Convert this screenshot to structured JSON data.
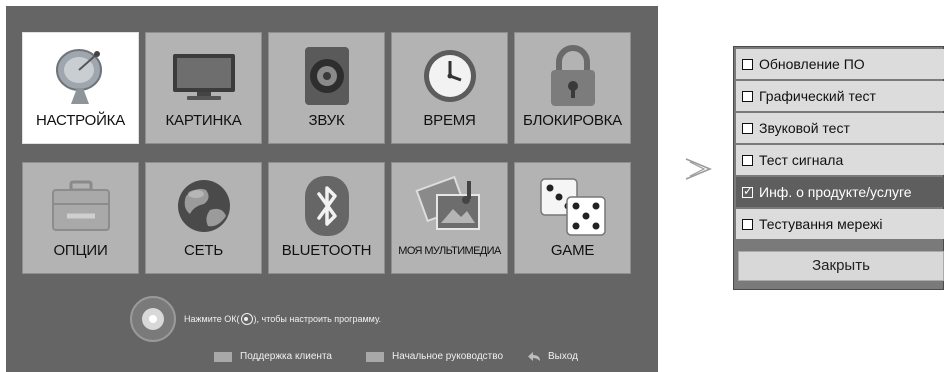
{
  "main_menu": {
    "tiles": [
      {
        "label": "НАСТРОЙКА",
        "icon": "satellite-dish-icon",
        "active": true
      },
      {
        "label": "КАРТИНКА",
        "icon": "tv-monitor-icon"
      },
      {
        "label": "ЗВУК",
        "icon": "speaker-icon"
      },
      {
        "label": "ВРЕМЯ",
        "icon": "clock-icon"
      },
      {
        "label": "БЛОКИРОВКА",
        "icon": "padlock-icon"
      },
      {
        "label": "ОПЦИИ",
        "icon": "toolbox-icon"
      },
      {
        "label": "СЕТЬ",
        "icon": "globe-icon"
      },
      {
        "label": "BLUETOOTH",
        "icon": "bluetooth-icon"
      },
      {
        "label": "МОЯ МУЛЬТИМЕДИА",
        "icon": "photos-icon"
      },
      {
        "label": "GAME",
        "icon": "dice-icon"
      }
    ],
    "hint_before": "Нажмите ОК(",
    "hint_after": "), чтобы настроить программу.",
    "footer": {
      "support": "Поддержка клиента",
      "guide": "Начальное руководство",
      "exit": "Выход"
    }
  },
  "popup": {
    "items": [
      {
        "label": "Обновление ПО",
        "checked": false
      },
      {
        "label": "Графический тест",
        "checked": false
      },
      {
        "label": "Звуковой тест",
        "checked": false
      },
      {
        "label": "Тест сигнала",
        "checked": false
      },
      {
        "label": "Инф. о продукте/услуге",
        "checked": true,
        "selected": true
      },
      {
        "label": "Тестування мережі",
        "checked": false
      }
    ],
    "close_label": "Закрыть"
  },
  "colors": {
    "screen_bg": "#656565",
    "tile_bg": "#b3b3b3",
    "selected_row": "#5e5e5e"
  }
}
